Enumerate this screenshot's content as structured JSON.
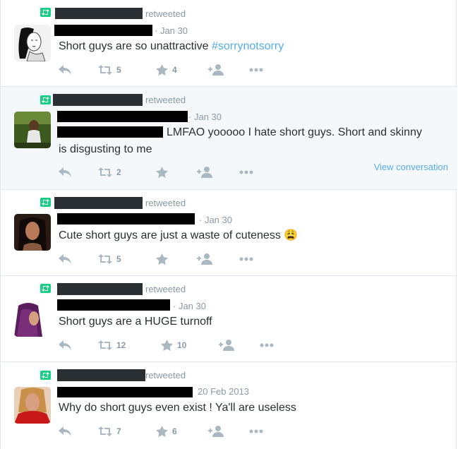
{
  "colors": {
    "retweet_green": "#19cf86",
    "link_blue": "#55acee",
    "meta_grey": "#8899a6",
    "text": "#292f33",
    "icon_grey": "#aab8c2",
    "highlight_bg": "#f5f8fa"
  },
  "icons": {
    "retweet_badge": "retweet-badge-icon",
    "reply": "reply-icon",
    "retweet": "retweet-icon",
    "favorite": "star-icon",
    "follow": "follow-icon",
    "more": "more-icon"
  },
  "tweets": [
    {
      "retweeted_label": "retweeted",
      "date": "· Jan 30",
      "text": "Short guys are so unattractive ",
      "hashtag": "#sorrynotsorry",
      "retweets": "5",
      "favorites": "4"
    },
    {
      "retweeted_label": "retweeted",
      "date": "· Jan 30",
      "text": "LMFAO yooooo I hate short guys. Short and skinny",
      "text_line2": "is disgusting to me",
      "retweets": "2",
      "favorites": "",
      "view_conversation": "View conversation"
    },
    {
      "retweeted_label": "retweeted",
      "date": "· Jan 30",
      "text": "Cute short guys are just a waste of  cuteness 😩",
      "retweets": "5",
      "favorites": ""
    },
    {
      "retweeted_label": "retweeted",
      "date": "· Jan 30",
      "text": "Short guys are a HUGE turnoff",
      "retweets": "12",
      "favorites": "10"
    },
    {
      "retweeted_label": "retweeted",
      "date": "20 Feb 2013",
      "text": "Why do short guys even exist ! Ya'll are useless",
      "retweets": "7",
      "favorites": "6"
    }
  ]
}
